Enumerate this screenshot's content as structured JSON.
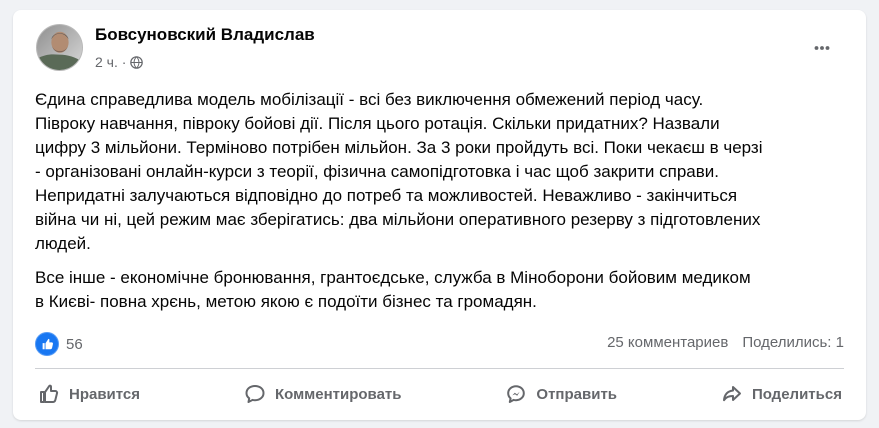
{
  "post": {
    "author": "Бовсуновский Владислав",
    "timestamp": "2 ч. ·",
    "paragraphs": [
      [
        "Єдина справедлива модель мобілізації - всі без виключення обмежений період часу.",
        "Півроку навчання, півроку бойові дії. Після цього ротація. Скільки придатних? Назвали",
        "цифру 3 мільйони. Терміново потрібен мільйон. За 3 роки пройдуть всі. Поки чекаєш в черзі",
        "- організовані онлайн-курси з теорії, фізична самопідготовка і час щоб закрити справи.",
        "Непридатні залучаються відповідно до потреб та можливостей. Неважливо - закінчиться",
        "війна чи ні, цей режим має зберігатись: два мільйони оперативного резерву з підготовлених",
        "людей."
      ],
      [
        "Все інше - економічне бронювання, грантоєдське, служба в Міноборони бойовим медиком",
        "в Києві- повна хрєнь, метою якою є подоїти бізнес та громадян."
      ]
    ]
  },
  "reactions": {
    "count": "56",
    "icon": "like-icon"
  },
  "stats": {
    "comments": "25 комментариев",
    "shares": "Поделились: 1"
  },
  "actions": {
    "like": "Нравится",
    "comment": "Комментировать",
    "send": "Отправить",
    "share": "Поделиться"
  },
  "colors": {
    "background": "#f0f2f5",
    "card": "#ffffff",
    "text_primary": "#050505",
    "text_secondary": "#65676b",
    "facebook_blue": "#1877f2"
  }
}
